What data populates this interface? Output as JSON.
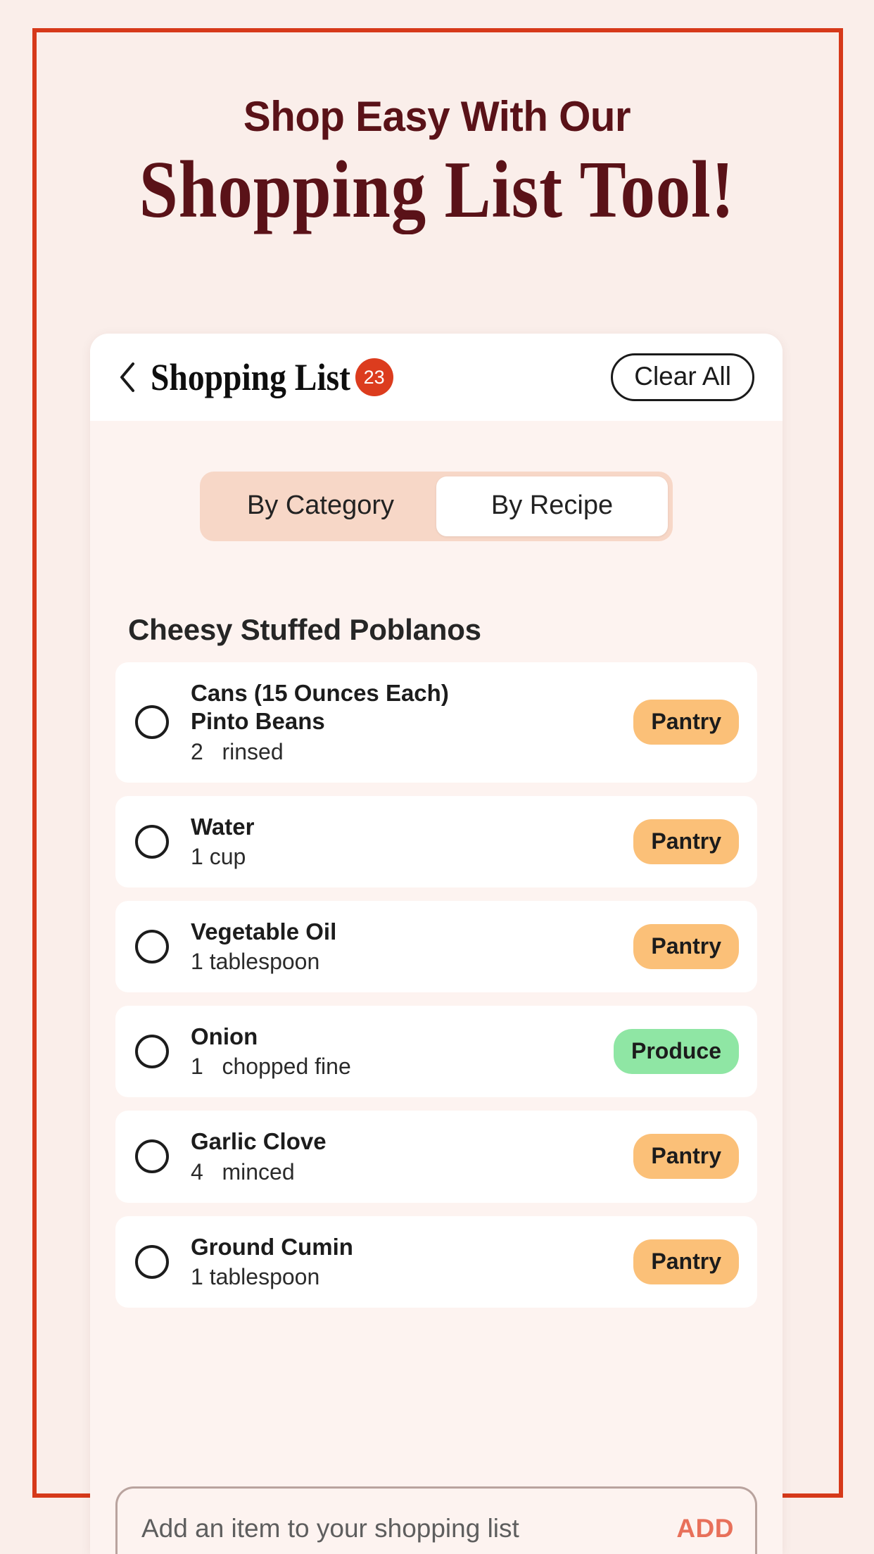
{
  "theme": {
    "page_background": "#FAEEEA",
    "frame_border": "#D6391A",
    "headline_color": "#5A1218",
    "badge_red": "#DC3C1E",
    "accent_salmon": "#E8705A",
    "toggle_track": "#F7D7C7",
    "pantry_badge": "#FBC078",
    "produce_badge": "#8FE6A4"
  },
  "headline": {
    "line1": "Shop Easy With Our",
    "line2": "Shopping List Tool!"
  },
  "app": {
    "header": {
      "back_icon": "chevron-left-icon",
      "title": "Shopping List",
      "count_badge": "23",
      "clear_all_label": "Clear All"
    },
    "view_toggle": {
      "options": [
        {
          "label": "By Category",
          "active": false
        },
        {
          "label": "By Recipe",
          "active": true
        }
      ]
    },
    "groups": [
      {
        "title": "Cheesy Stuffed Poblanos",
        "items": [
          {
            "name": "Cans (15 Ounces Each)\nPinto Beans",
            "qty": "2   rinsed",
            "badge": "Pantry",
            "badge_color": "#FBC078",
            "checked": false
          },
          {
            "name": "Water",
            "qty": "1 cup",
            "badge": "Pantry",
            "badge_color": "#FBC078",
            "checked": false
          },
          {
            "name": "Vegetable Oil",
            "qty": "1 tablespoon",
            "badge": "Pantry",
            "badge_color": "#FBC078",
            "checked": false
          },
          {
            "name": "Onion",
            "qty": "1   chopped fine",
            "badge": "Produce",
            "badge_color": "#8FE6A4",
            "checked": false
          },
          {
            "name": "Garlic Clove",
            "qty": "4   minced",
            "badge": "Pantry",
            "badge_color": "#FBC078",
            "checked": false
          },
          {
            "name": "Ground Cumin",
            "qty": "1 tablespoon",
            "badge": "Pantry",
            "badge_color": "#FBC078",
            "checked": false
          }
        ]
      }
    ],
    "add_bar": {
      "placeholder": "Add an item to your shopping list",
      "value": "",
      "add_label": "ADD"
    }
  }
}
